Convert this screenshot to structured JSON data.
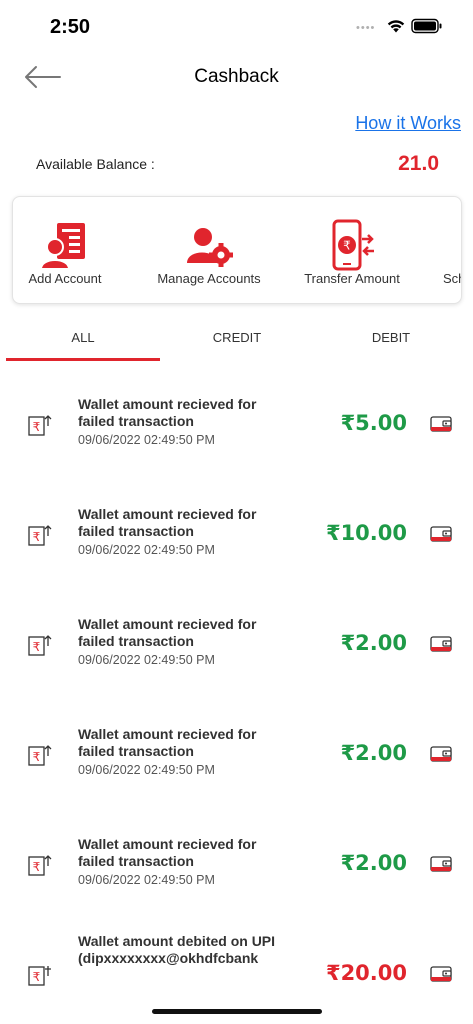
{
  "status_bar": {
    "time": "2:50",
    "dots": "••••"
  },
  "header": {
    "title": "Cashback"
  },
  "how_it_works": "How it Works",
  "balance": {
    "label": "Available Balance :",
    "value": "21.0"
  },
  "actions": [
    {
      "label": "Add Account",
      "icon": "add-account-icon"
    },
    {
      "label": "Manage Accounts",
      "icon": "manage-accounts-icon"
    },
    {
      "label": "Transfer Amount",
      "icon": "transfer-amount-icon"
    },
    {
      "label": "Sch",
      "icon": "schedule-icon"
    }
  ],
  "tabs": [
    {
      "label": "ALL",
      "active": true
    },
    {
      "label": "CREDIT",
      "active": false
    },
    {
      "label": "DEBIT",
      "active": false
    }
  ],
  "transactions": [
    {
      "title": "Wallet amount recieved for failed transaction",
      "date": "09/06/2022 02:49:50 PM",
      "amount": "₹5.00",
      "type": "credit"
    },
    {
      "title": "Wallet amount recieved for failed transaction",
      "date": "09/06/2022 02:49:50 PM",
      "amount": "₹10.00",
      "type": "credit"
    },
    {
      "title": "Wallet amount recieved for failed transaction",
      "date": "09/06/2022 02:49:50 PM",
      "amount": "₹2.00",
      "type": "credit"
    },
    {
      "title": "Wallet amount recieved for failed transaction",
      "date": "09/06/2022 02:49:50 PM",
      "amount": "₹2.00",
      "type": "credit"
    },
    {
      "title": "Wallet amount recieved for failed transaction",
      "date": "09/06/2022 02:49:50 PM",
      "amount": "₹2.00",
      "type": "credit"
    },
    {
      "title": "Wallet amount debited on UPI (dipxxxxxxxx@okhdfcbank",
      "date": "",
      "amount": "₹20.00",
      "type": "debit"
    }
  ],
  "colors": {
    "accent": "#e0252d",
    "credit": "#1e9a47",
    "link": "#1a73e8"
  }
}
